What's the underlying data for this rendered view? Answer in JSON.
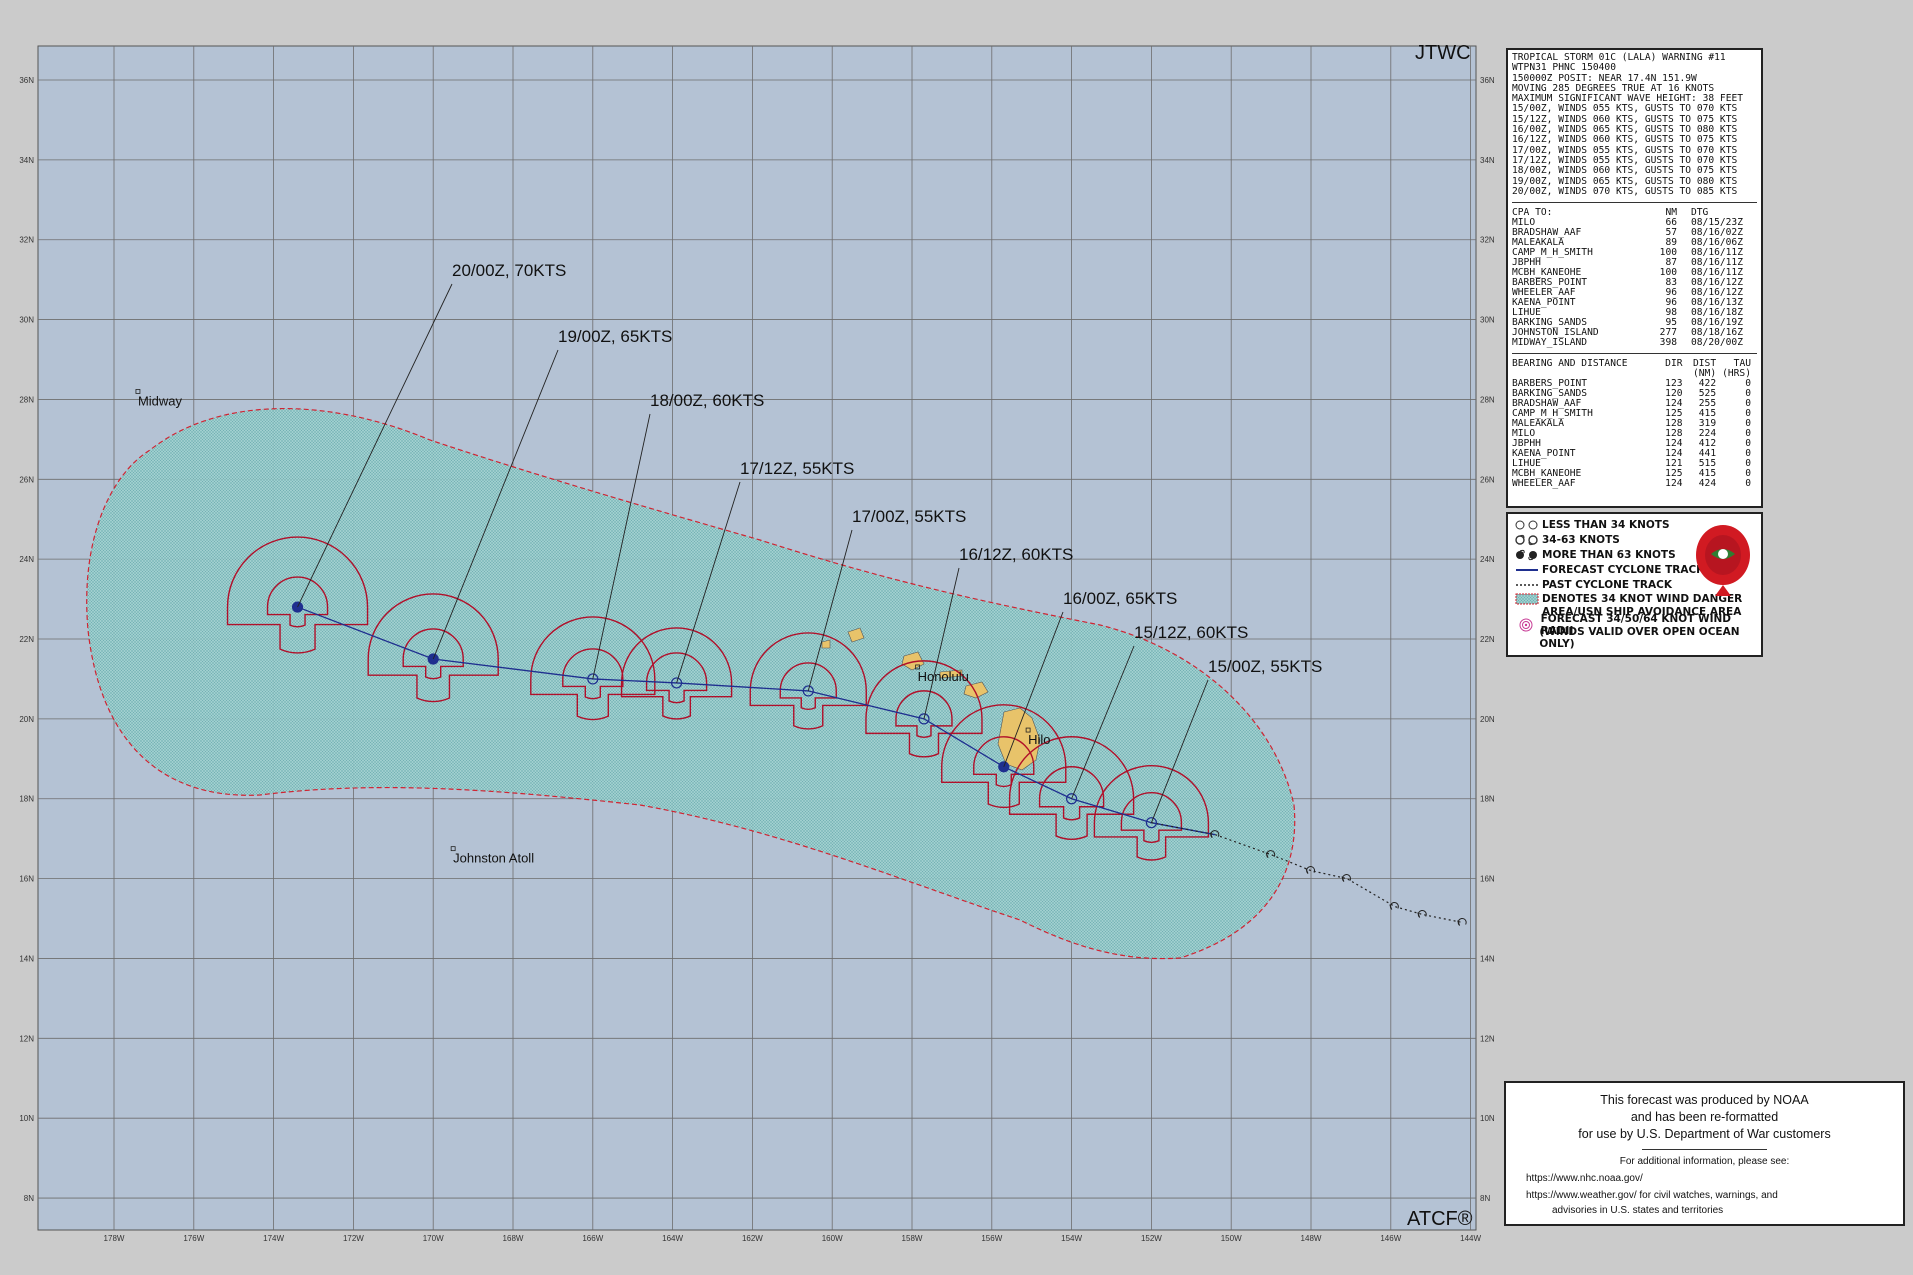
{
  "map": {
    "corner_top": "JTWC",
    "corner_bottom": "ATCF®",
    "lon_labels": [
      "178W",
      "176W",
      "174W",
      "172W",
      "170W",
      "168W",
      "166W",
      "164W",
      "162W",
      "160W",
      "158W",
      "156W",
      "154W",
      "152W",
      "150W",
      "148W",
      "146W",
      "144W"
    ],
    "lat_labels": [
      "36N",
      "34N",
      "32N",
      "30N",
      "28N",
      "26N",
      "24N",
      "22N",
      "20N",
      "18N",
      "16N",
      "14N",
      "12N",
      "10N",
      "8N"
    ],
    "places": [
      {
        "name": "Midway",
        "lon": -177.4,
        "lat": 28.2
      },
      {
        "name": "Johnston Atoll",
        "lon": -169.5,
        "lat": 16.75
      },
      {
        "name": "Honolulu",
        "lon": -157.86,
        "lat": 21.3
      },
      {
        "name": "Hilo",
        "lon": -155.09,
        "lat": 19.72
      }
    ],
    "forecast_points": [
      {
        "label": "15/00Z,  55KTS",
        "lon": -152.0,
        "lat": 17.4,
        "kts": 55
      },
      {
        "label": "15/12Z,  60KTS",
        "lon": -154.0,
        "lat": 18.0,
        "kts": 60
      },
      {
        "label": "16/00Z,  65KTS",
        "lon": -155.7,
        "lat": 18.8,
        "kts": 65
      },
      {
        "label": "16/12Z,  60KTS",
        "lon": -157.7,
        "lat": 20.0,
        "kts": 60
      },
      {
        "label": "17/00Z,  55KTS",
        "lon": -160.6,
        "lat": 20.7,
        "kts": 55
      },
      {
        "label": "17/12Z,  55KTS",
        "lon": -163.9,
        "lat": 20.9,
        "kts": 55
      },
      {
        "label": "18/00Z,  60KTS",
        "lon": -166.0,
        "lat": 21.0,
        "kts": 60
      },
      {
        "label": "19/00Z,  65KTS",
        "lon": -170.0,
        "lat": 21.5,
        "kts": 65
      },
      {
        "label": "20/00Z,  70KTS",
        "lon": -173.4,
        "lat": 22.8,
        "kts": 70
      }
    ],
    "past_track": [
      {
        "lon": -150.4,
        "lat": 17.1
      },
      {
        "lon": -149.0,
        "lat": 16.6
      },
      {
        "lon": -148.0,
        "lat": 16.2
      },
      {
        "lon": -147.1,
        "lat": 16.0
      },
      {
        "lon": -145.9,
        "lat": 15.3
      },
      {
        "lon": -145.2,
        "lat": 15.1
      },
      {
        "lon": -144.2,
        "lat": 14.9
      }
    ]
  },
  "warning": {
    "header": [
      "TROPICAL STORM 01C (LALA) WARNING #11",
      "WTPN31 PHNC 150400",
      "150000Z POSIT: NEAR 17.4N 151.9W",
      "MOVING 285 DEGREES TRUE AT 16 KNOTS",
      "MAXIMUM SIGNIFICANT WAVE HEIGHT: 38 FEET",
      "15/00Z, WINDS 055 KTS, GUSTS TO 070 KTS",
      "15/12Z, WINDS 060 KTS, GUSTS TO 075 KTS",
      "16/00Z, WINDS 065 KTS, GUSTS TO 080 KTS",
      "16/12Z, WINDS 060 KTS, GUSTS TO 075 KTS",
      "17/00Z, WINDS 055 KTS, GUSTS TO 070 KTS",
      "17/12Z, WINDS 055 KTS, GUSTS TO 070 KTS",
      "18/00Z, WINDS 060 KTS, GUSTS TO 075 KTS",
      "19/00Z, WINDS 065 KTS, GUSTS TO 080 KTS",
      "20/00Z, WINDS 070 KTS, GUSTS TO 085 KTS"
    ],
    "cpa": {
      "title": "CPA TO:",
      "col_nm": "NM",
      "col_dtg": "DTG",
      "rows": [
        [
          "MILO",
          "66",
          "08/15/23Z"
        ],
        [
          "BRADSHAW_AAF",
          "57",
          "08/16/02Z"
        ],
        [
          "MALEAKALA",
          "89",
          "08/16/06Z"
        ],
        [
          "CAMP_M_H_SMITH",
          "100",
          "08/16/11Z"
        ],
        [
          "JBPHH",
          "87",
          "08/16/11Z"
        ],
        [
          "MCBH_KANEOHE",
          "100",
          "08/16/11Z"
        ],
        [
          "BARBERS_POINT",
          "83",
          "08/16/12Z"
        ],
        [
          "WHEELER_AAF",
          "96",
          "08/16/12Z"
        ],
        [
          "KAENA_POINT",
          "96",
          "08/16/13Z"
        ],
        [
          "LIHUE",
          "98",
          "08/16/18Z"
        ],
        [
          "BARKING_SANDS",
          "95",
          "08/16/19Z"
        ],
        [
          "JOHNSTON_ISLAND",
          "277",
          "08/18/16Z"
        ],
        [
          "MIDWAY_ISLAND",
          "398",
          "08/20/00Z"
        ]
      ]
    },
    "bearing": {
      "title": "BEARING AND DISTANCE",
      "col_dir": "DIR",
      "col_dist": "DIST",
      "col_tau": "TAU",
      "col_dist_unit": "(NM)",
      "col_tau_unit": "(HRS)",
      "rows": [
        [
          "BARBERS_POINT",
          "123",
          "422",
          "0"
        ],
        [
          "BARKING_SANDS",
          "120",
          "525",
          "0"
        ],
        [
          "BRADSHAW_AAF",
          "124",
          "255",
          "0"
        ],
        [
          "CAMP_M_H_SMITH",
          "125",
          "415",
          "0"
        ],
        [
          "MALEAKALA",
          "128",
          "319",
          "0"
        ],
        [
          "MILO",
          "128",
          "224",
          "0"
        ],
        [
          "JBPHH",
          "124",
          "412",
          "0"
        ],
        [
          "KAENA_POINT",
          "124",
          "441",
          "0"
        ],
        [
          "LIHUE",
          "121",
          "515",
          "0"
        ],
        [
          "MCBH_KANEOHE",
          "125",
          "415",
          "0"
        ],
        [
          "WHEELER_AAF",
          "124",
          "424",
          "0"
        ]
      ]
    }
  },
  "legend": {
    "items": [
      "LESS THAN 34 KNOTS",
      "34-63 KNOTS",
      "MORE THAN 63 KNOTS",
      "FORECAST CYCLONE TRACK",
      "PAST CYCLONE TRACK",
      "DENOTES 34 KNOT WIND DANGER",
      "AREA/USN SHIP AVOIDANCE AREA",
      "FORECAST 34/50/64 KNOT WIND RADII",
      "(WINDS VALID OVER OPEN OCEAN ONLY)"
    ],
    "colors": {
      "track": "#1f2f8f",
      "radii": "#b0102a",
      "danger": "#8fc9c9"
    }
  },
  "notice": {
    "line1": "This forecast was produced by NOAA",
    "line2": "and has been re-formatted",
    "line3": "for use by U.S. Department of War customers",
    "line4": "For additional information, please see:",
    "line5": "https://www.nhc.noaa.gov/",
    "line6": "https://www.weather.gov/ for civil watches, warnings, and",
    "line7": "advisories in U.S. states and territories"
  }
}
